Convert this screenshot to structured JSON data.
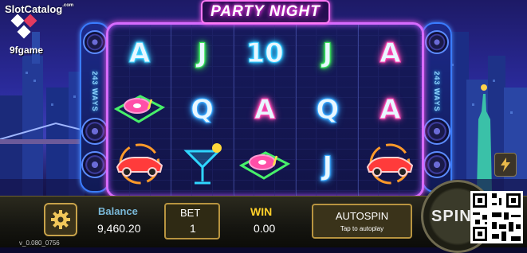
{
  "header": {
    "site_logo": "SlotCatalog",
    "site_logo_suffix": ".com",
    "brand": "9fgame",
    "game_title": "PARTY NIGHT",
    "ways_left": "243 WAYS",
    "ways_right": "243 WAYS"
  },
  "reels": [
    [
      {
        "symbol": "A",
        "icon": "neon-a",
        "color": "#3fd2ff"
      },
      {
        "symbol": "",
        "icon": "turntable-icon",
        "color": "#47f06a"
      },
      {
        "symbol": "",
        "icon": "sports-car-icon",
        "color": "#ff3b3b"
      }
    ],
    [
      {
        "symbol": "J",
        "icon": "neon-j",
        "color": "#39e85a"
      },
      {
        "symbol": "Q",
        "icon": "neon-q",
        "color": "#38a8ff"
      },
      {
        "symbol": "",
        "icon": "cocktail-icon",
        "color": "#2fd6ff"
      }
    ],
    [
      {
        "symbol": "10",
        "icon": "neon-10",
        "color": "#2fc8ff"
      },
      {
        "symbol": "A",
        "icon": "neon-a",
        "color": "#ff4bb4"
      },
      {
        "symbol": "",
        "icon": "turntable-icon",
        "color": "#47f06a"
      }
    ],
    [
      {
        "symbol": "J",
        "icon": "neon-j",
        "color": "#39e85a"
      },
      {
        "symbol": "Q",
        "icon": "neon-q",
        "color": "#38a8ff"
      },
      {
        "symbol": "J",
        "icon": "neon-j",
        "color": "#38a8ff"
      }
    ],
    [
      {
        "symbol": "A",
        "icon": "neon-a",
        "color": "#ff4bb4"
      },
      {
        "symbol": "A",
        "icon": "neon-a",
        "color": "#ff4bb4"
      },
      {
        "symbol": "",
        "icon": "sports-car-icon",
        "color": "#ff3b3b"
      }
    ]
  ],
  "controls": {
    "balance_label": "Balance",
    "balance_value": "9,460.20",
    "bet_label": "BET",
    "bet_value": "1",
    "win_label": "WIN",
    "win_value": "0.00",
    "autospin_label": "AUTOSPIN",
    "autospin_sub": "Tap to autoplay",
    "spin_label": "SPIN",
    "settings_icon": "gear-icon",
    "side_icon": "lightning-icon"
  },
  "version": "v_0.080_0756",
  "colors": {
    "frame_neon": "#d86bff",
    "gold": "#c7a24a",
    "win_yellow": "#ffd02a",
    "balance_blue": "#79b8d8"
  }
}
